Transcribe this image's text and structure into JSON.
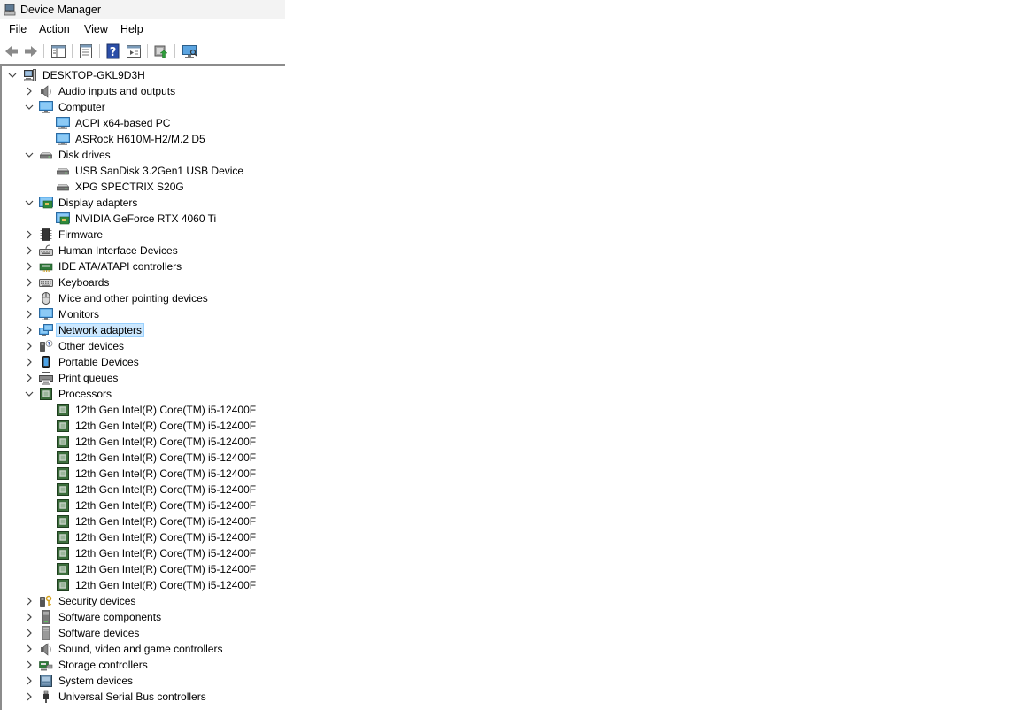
{
  "window": {
    "title": "Device Manager"
  },
  "menu": {
    "file": "File",
    "action": "Action",
    "view": "View",
    "help": "Help"
  },
  "toolbar": {
    "buttons": [
      "back-icon",
      "forward-icon",
      "tree-view-icon",
      "properties-icon",
      "help-icon",
      "action-view-icon",
      "update-driver-icon",
      "monitor-scan-icon"
    ]
  },
  "colors": {
    "selection_bg": "#cce8ff",
    "selection_border": "#99d1ff",
    "border": "#8c8c8c"
  },
  "tree": [
    {
      "label": "DESKTOP-GKL9D3H",
      "level": 0,
      "chevron": "expanded",
      "icon": "computer-root-icon"
    },
    {
      "label": "Audio inputs and outputs",
      "level": 1,
      "chevron": "collapsed",
      "icon": "speaker-icon"
    },
    {
      "label": "Computer",
      "level": 1,
      "chevron": "expanded",
      "icon": "monitor-icon"
    },
    {
      "label": "ACPI x64-based PC",
      "level": 2,
      "chevron": "none",
      "icon": "monitor-icon"
    },
    {
      "label": "ASRock H610M-H2/M.2 D5",
      "level": 2,
      "chevron": "none",
      "icon": "monitor-icon"
    },
    {
      "label": "Disk drives",
      "level": 1,
      "chevron": "expanded",
      "icon": "disk-icon"
    },
    {
      "label": "USB  SanDisk 3.2Gen1 USB Device",
      "level": 2,
      "chevron": "none",
      "icon": "disk-icon"
    },
    {
      "label": "XPG SPECTRIX S20G",
      "level": 2,
      "chevron": "none",
      "icon": "disk-icon"
    },
    {
      "label": "Display adapters",
      "level": 1,
      "chevron": "expanded",
      "icon": "display-adapter-icon"
    },
    {
      "label": "NVIDIA GeForce RTX 4060 Ti",
      "level": 2,
      "chevron": "none",
      "icon": "display-adapter-icon"
    },
    {
      "label": "Firmware",
      "level": 1,
      "chevron": "collapsed",
      "icon": "firmware-icon"
    },
    {
      "label": "Human Interface Devices",
      "level": 1,
      "chevron": "collapsed",
      "icon": "hid-icon"
    },
    {
      "label": "IDE ATA/ATAPI controllers",
      "level": 1,
      "chevron": "collapsed",
      "icon": "ide-icon"
    },
    {
      "label": "Keyboards",
      "level": 1,
      "chevron": "collapsed",
      "icon": "keyboard-icon"
    },
    {
      "label": "Mice and other pointing devices",
      "level": 1,
      "chevron": "collapsed",
      "icon": "mouse-icon"
    },
    {
      "label": "Monitors",
      "level": 1,
      "chevron": "collapsed",
      "icon": "monitor-icon"
    },
    {
      "label": "Network adapters",
      "level": 1,
      "chevron": "collapsed",
      "icon": "network-icon",
      "selected": true
    },
    {
      "label": "Other devices",
      "level": 1,
      "chevron": "collapsed",
      "icon": "unknown-device-icon"
    },
    {
      "label": "Portable Devices",
      "level": 1,
      "chevron": "collapsed",
      "icon": "portable-device-icon"
    },
    {
      "label": "Print queues",
      "level": 1,
      "chevron": "collapsed",
      "icon": "printer-icon"
    },
    {
      "label": "Processors",
      "level": 1,
      "chevron": "expanded",
      "icon": "processor-icon"
    },
    {
      "label": "12th Gen Intel(R) Core(TM) i5-12400F",
      "level": 2,
      "chevron": "none",
      "icon": "processor-icon"
    },
    {
      "label": "12th Gen Intel(R) Core(TM) i5-12400F",
      "level": 2,
      "chevron": "none",
      "icon": "processor-icon"
    },
    {
      "label": "12th Gen Intel(R) Core(TM) i5-12400F",
      "level": 2,
      "chevron": "none",
      "icon": "processor-icon"
    },
    {
      "label": "12th Gen Intel(R) Core(TM) i5-12400F",
      "level": 2,
      "chevron": "none",
      "icon": "processor-icon"
    },
    {
      "label": "12th Gen Intel(R) Core(TM) i5-12400F",
      "level": 2,
      "chevron": "none",
      "icon": "processor-icon"
    },
    {
      "label": "12th Gen Intel(R) Core(TM) i5-12400F",
      "level": 2,
      "chevron": "none",
      "icon": "processor-icon"
    },
    {
      "label": "12th Gen Intel(R) Core(TM) i5-12400F",
      "level": 2,
      "chevron": "none",
      "icon": "processor-icon"
    },
    {
      "label": "12th Gen Intel(R) Core(TM) i5-12400F",
      "level": 2,
      "chevron": "none",
      "icon": "processor-icon"
    },
    {
      "label": "12th Gen Intel(R) Core(TM) i5-12400F",
      "level": 2,
      "chevron": "none",
      "icon": "processor-icon"
    },
    {
      "label": "12th Gen Intel(R) Core(TM) i5-12400F",
      "level": 2,
      "chevron": "none",
      "icon": "processor-icon"
    },
    {
      "label": "12th Gen Intel(R) Core(TM) i5-12400F",
      "level": 2,
      "chevron": "none",
      "icon": "processor-icon"
    },
    {
      "label": "12th Gen Intel(R) Core(TM) i5-12400F",
      "level": 2,
      "chevron": "none",
      "icon": "processor-icon"
    },
    {
      "label": "Security devices",
      "level": 1,
      "chevron": "collapsed",
      "icon": "security-icon"
    },
    {
      "label": "Software components",
      "level": 1,
      "chevron": "collapsed",
      "icon": "software-component-icon"
    },
    {
      "label": "Software devices",
      "level": 1,
      "chevron": "collapsed",
      "icon": "software-device-icon"
    },
    {
      "label": "Sound, video and game controllers",
      "level": 1,
      "chevron": "collapsed",
      "icon": "speaker-icon"
    },
    {
      "label": "Storage controllers",
      "level": 1,
      "chevron": "collapsed",
      "icon": "storage-controller-icon"
    },
    {
      "label": "System devices",
      "level": 1,
      "chevron": "collapsed",
      "icon": "system-device-icon"
    },
    {
      "label": "Universal Serial Bus controllers",
      "level": 1,
      "chevron": "collapsed",
      "icon": "usb-icon"
    }
  ]
}
